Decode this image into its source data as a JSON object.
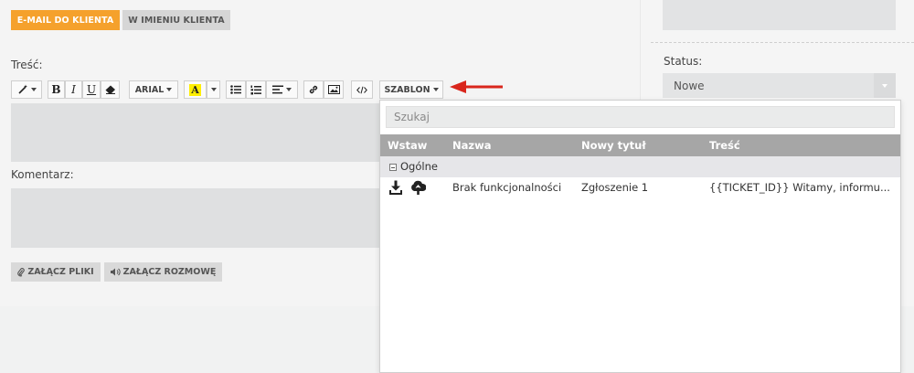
{
  "tabs": {
    "email": "E-MAIL DO KLIENTA",
    "imieniu": "W IMIENIU KLIENTA"
  },
  "labels": {
    "tresc": "Treść:",
    "komentarz": "Komentarz:",
    "status": "Status:"
  },
  "toolbar": {
    "font": "ARIAL",
    "highlight_letter": "A",
    "template": "SZABLON"
  },
  "attach": {
    "files": "ZAŁĄCZ PLIKI",
    "conversation": "ZAŁĄCZ ROZMOWĘ"
  },
  "status": {
    "value": "Nowe"
  },
  "dropdown": {
    "search_placeholder": "Szukaj",
    "columns": [
      "Wstaw",
      "Nazwa",
      "Nowy tytuł",
      "Treść"
    ],
    "group": "Ogólne",
    "rows": [
      {
        "name": "Brak funkcjonalności",
        "title": "Zgłoszenie 1",
        "content": "{{TICKET_ID}} Witamy, informu..."
      }
    ]
  },
  "colors": {
    "accent": "#f5a12c",
    "annotation_arrow": "#d9261c"
  }
}
